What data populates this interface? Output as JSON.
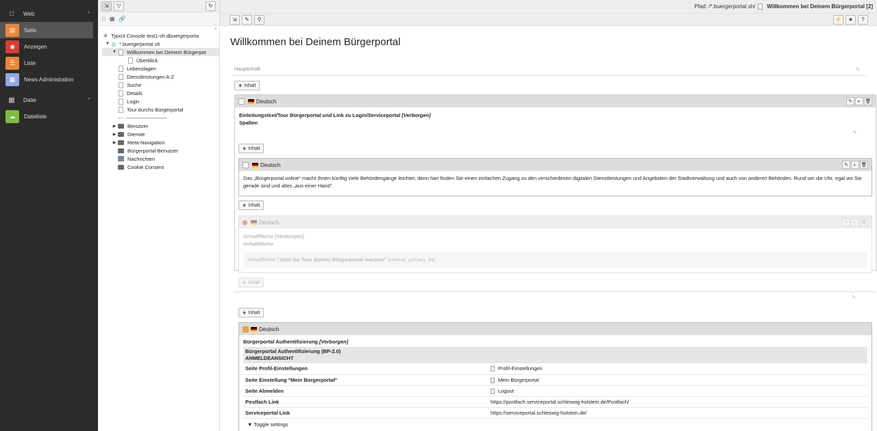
{
  "modules": {
    "web_group": "Web",
    "web_items": [
      {
        "label": "Seite",
        "icon": "page-icon",
        "color": "#ef8532",
        "active": true
      },
      {
        "label": "Anzeigen",
        "icon": "eye-icon",
        "color": "#dd3b2e"
      },
      {
        "label": "Liste",
        "icon": "list-icon",
        "color": "#ef8532"
      },
      {
        "label": "News Administration",
        "icon": "news-icon",
        "color": "#8fa8e6"
      }
    ],
    "file_group": "Datei",
    "file_items": [
      {
        "label": "Dateiliste",
        "icon": "cloud-icon",
        "color": "#7bbd3b"
      }
    ]
  },
  "tree": {
    "nodes": [
      {
        "label": "Typo3 Console test1-sh.dbuergerporta",
        "level": 0,
        "type": "root"
      },
      {
        "label": "*.buergerportal.sh",
        "level": 1,
        "type": "site",
        "toggle": "▼"
      },
      {
        "label": "Willkommen bei Deinem Bürgerpor",
        "level": 2,
        "type": "doc",
        "toggle": "▼",
        "selected": true
      },
      {
        "label": "Überblick",
        "level": 3,
        "type": "doc"
      },
      {
        "label": "Lebenslagen",
        "level": 2,
        "type": "doc"
      },
      {
        "label": "Dienstleistungen A-Z",
        "level": 2,
        "type": "doc"
      },
      {
        "label": "Suche",
        "level": 2,
        "type": "doc"
      },
      {
        "label": "Details",
        "level": 2,
        "type": "doc"
      },
      {
        "label": "Login",
        "level": 2,
        "type": "doc"
      },
      {
        "label": "Tour durchs Bürgerportal",
        "level": 2,
        "type": "doc"
      },
      {
        "label": "------------------------",
        "level": 2,
        "type": "sep"
      },
      {
        "label": "Benutzer",
        "level": 2,
        "type": "folder",
        "toggle": "▶"
      },
      {
        "label": "Dienste",
        "level": 2,
        "type": "folder",
        "toggle": "▶"
      },
      {
        "label": "Meta-Navigation",
        "level": 2,
        "type": "folder",
        "toggle": "▶"
      },
      {
        "label": "Bürgerportal-Benutzer",
        "level": 2,
        "type": "folder"
      },
      {
        "label": "Nachrichten",
        "level": 2,
        "type": "sysf"
      },
      {
        "label": "Cookie Consent",
        "level": 2,
        "type": "folder"
      }
    ]
  },
  "header": {
    "path_label": "Pfad: /*.buergerportal.sh/",
    "page_label": "Willkommen bei Deinem Bürgerportal [2]"
  },
  "page": {
    "title": "Willkommen bei Deinem Bürgerportal",
    "column": "Hauptinhalt",
    "add_content": "Inhalt",
    "lang": "Deutsch"
  },
  "ce1": {
    "line1": "Einleitungstext/Tour Bürgerportal und Link zu Login/Serviceportal",
    "hidden": "[Verborgen]",
    "line2": "Spalten"
  },
  "ce2": {
    "text": "Das „Bürgerportal online“ macht Ihnen künftig viele Behördengänge leichter, denn hier finden Sie einen einfachen Zugang zu den verschiedenen digitalen Dienstleistungen und Angeboten der Stadtverwaltung und auch von anderen Behörden. Rund um die Uhr, egal wo Sie gerade sind und alles „aus einer Hand“."
  },
  "ce3": {
    "line1": "Schaltfläche",
    "hidden": "[Verborgen]",
    "line2": "Schaltfläche",
    "detail_prefix": "Schaltfläche",
    "detail_title": "\"Jetzt die Tour durchs Bürgerportal machen\"",
    "detail_suffix": "(normal, primary, 64)"
  },
  "ce4": {
    "title": "Bürgerportal Authentifizierung",
    "hidden": "[Verborgen]",
    "plugin": "Bürgerportal Authentifizierung (BP-2.0)",
    "view": "ANMELDEANSICHT",
    "rows": [
      {
        "key": "Seite Profil-Einstellungen",
        "value": "Profil-Einstellungen",
        "page": true
      },
      {
        "key": "Seite Einstellung \"Mein Bürgerportal\"",
        "value": "Mein Bürgerportal",
        "page": true
      },
      {
        "key": "Seite Abmelden",
        "value": "Logout",
        "page": true
      },
      {
        "key": "Postfach Link",
        "value": "https://postfach.serviceportal.schleswig-holstein.de/Postfach/",
        "page": false
      },
      {
        "key": "Serviceportal Link",
        "value": "https://serviceportal.schleswig-holstein.de/",
        "page": false
      }
    ],
    "toggle": "Toggle settings"
  }
}
